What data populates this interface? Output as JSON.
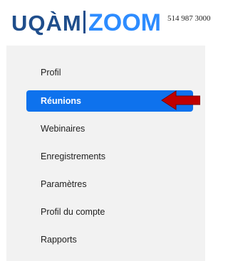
{
  "header": {
    "logo_uqam": "UQÀM",
    "logo_zoom": "ZOOM",
    "phone": "514 987 3000",
    "colors": {
      "uqam_blue": "#1f4e8c",
      "zoom_blue": "#2d8cff"
    }
  },
  "sidebar": {
    "items": [
      {
        "label": "Profil",
        "active": false
      },
      {
        "label": "Réunions",
        "active": true
      },
      {
        "label": "Webinaires",
        "active": false
      },
      {
        "label": "Enregistrements",
        "active": false
      },
      {
        "label": "Paramètres",
        "active": false
      },
      {
        "label": "Profil du compte",
        "active": false
      },
      {
        "label": "Rapports",
        "active": false
      }
    ],
    "active_color": "#0e72ed"
  },
  "annotation": {
    "icon": "red-arrow-left-icon",
    "color": "#c00000"
  }
}
